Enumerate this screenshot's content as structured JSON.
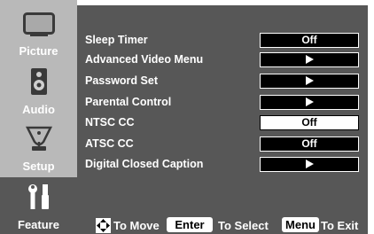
{
  "sidebar": {
    "tabs": [
      {
        "label": "Picture",
        "icon": "tv-icon",
        "active": false
      },
      {
        "label": "Audio",
        "icon": "speaker-icon",
        "active": false
      },
      {
        "label": "Setup",
        "icon": "satellite-dish-icon",
        "active": false
      },
      {
        "label": "Feature",
        "icon": "tools-icon",
        "active": true
      }
    ]
  },
  "menu": {
    "items": [
      {
        "label": "Sleep Timer",
        "value": "Off",
        "style": "dark"
      },
      {
        "label": "Advanced Video Menu",
        "value": "",
        "icon": "arrow-right-icon",
        "style": "dark"
      },
      {
        "label": "Password Set",
        "value": "",
        "icon": "arrow-right-icon",
        "style": "dark"
      },
      {
        "label": "Parental Control",
        "value": "",
        "icon": "arrow-right-icon",
        "style": "dark"
      },
      {
        "label": "NTSC CC",
        "value": "Off",
        "style": "light"
      },
      {
        "label": "ATSC CC",
        "value": "Off",
        "style": "dark"
      },
      {
        "label": "Digital Closed Caption",
        "value": "",
        "icon": "arrow-right-icon",
        "style": "dark"
      }
    ]
  },
  "footer": {
    "move_text": "To Move",
    "enter_key": "Enter",
    "select_text": "To Select",
    "menu_key": "Menu",
    "exit_text": "To Exit"
  },
  "colors": {
    "sidebar_bg": "#b9b9b9",
    "panel_bg": "#575757",
    "text": "#ffffff"
  }
}
